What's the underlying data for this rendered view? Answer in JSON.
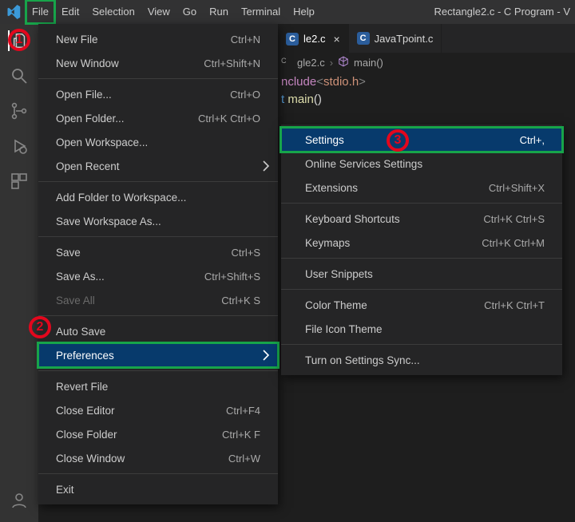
{
  "title_bar": {
    "window_title": "Rectangle2.c - C Program - V",
    "menu": {
      "file": "File",
      "edit": "Edit",
      "selection": "Selection",
      "view": "View",
      "go": "Go",
      "run": "Run",
      "terminal": "Terminal",
      "help": "Help"
    }
  },
  "tabs": {
    "active": {
      "label": "le2.c",
      "close_glyph": "×"
    },
    "inactive": {
      "label": "JavaTpoint.c"
    }
  },
  "breadcrumb": {
    "file": "gle2.c",
    "chevron": "›",
    "func": "main()"
  },
  "code": {
    "line1_a": "nclude",
    "line1_b": "<",
    "line1_c": "stdio.h",
    "line1_d": ">",
    "line2_a": "t ",
    "line2_b": "main",
    "line2_c": "()"
  },
  "file_menu": {
    "new_file": {
      "label": "New File",
      "shortcut": "Ctrl+N"
    },
    "new_window": {
      "label": "New Window",
      "shortcut": "Ctrl+Shift+N"
    },
    "open_file": {
      "label": "Open File...",
      "shortcut": "Ctrl+O"
    },
    "open_folder": {
      "label": "Open Folder...",
      "shortcut": "Ctrl+K Ctrl+O"
    },
    "open_workspace": {
      "label": "Open Workspace..."
    },
    "open_recent": {
      "label": "Open Recent"
    },
    "add_folder": {
      "label": "Add Folder to Workspace..."
    },
    "save_ws_as": {
      "label": "Save Workspace As..."
    },
    "save": {
      "label": "Save",
      "shortcut": "Ctrl+S"
    },
    "save_as": {
      "label": "Save As...",
      "shortcut": "Ctrl+Shift+S"
    },
    "save_all": {
      "label": "Save All",
      "shortcut": "Ctrl+K S"
    },
    "auto_save": {
      "label": "Auto Save"
    },
    "preferences": {
      "label": "Preferences"
    },
    "revert_file": {
      "label": "Revert File"
    },
    "close_editor": {
      "label": "Close Editor",
      "shortcut": "Ctrl+F4"
    },
    "close_folder": {
      "label": "Close Folder",
      "shortcut": "Ctrl+K F"
    },
    "close_window": {
      "label": "Close Window",
      "shortcut": "Ctrl+W"
    },
    "exit": {
      "label": "Exit"
    }
  },
  "pref_submenu": {
    "settings": {
      "label": "Settings",
      "shortcut": "Ctrl+,"
    },
    "online": {
      "label": "Online Services Settings"
    },
    "extensions": {
      "label": "Extensions",
      "shortcut": "Ctrl+Shift+X"
    },
    "kb_shortcuts": {
      "label": "Keyboard Shortcuts",
      "shortcut": "Ctrl+K Ctrl+S"
    },
    "keymaps": {
      "label": "Keymaps",
      "shortcut": "Ctrl+K Ctrl+M"
    },
    "snippets": {
      "label": "User Snippets"
    },
    "color_theme": {
      "label": "Color Theme",
      "shortcut": "Ctrl+K Ctrl+T"
    },
    "icon_theme": {
      "label": "File Icon Theme"
    },
    "sync": {
      "label": "Turn on Settings Sync..."
    }
  },
  "annotations": {
    "a1": "1",
    "a2": "2",
    "a3": "3"
  }
}
